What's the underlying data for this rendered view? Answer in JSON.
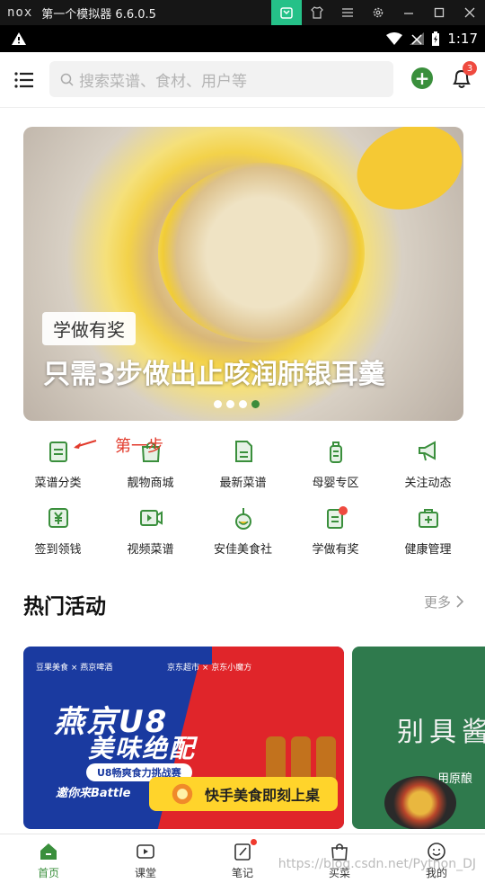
{
  "emulator": {
    "logo": "nox",
    "title": "第一个模拟器 6.6.0.5",
    "buttons": [
      "download-icon",
      "shirt-icon",
      "menu-icon",
      "gear-icon",
      "minimize-icon",
      "maximize-icon",
      "close-icon"
    ],
    "accent": "#25c188"
  },
  "status": {
    "time": "1:17"
  },
  "search": {
    "placeholder": "搜索菜谱、食材、用户等"
  },
  "notifications": {
    "badge": "3"
  },
  "banner": {
    "tag": "学做有奖",
    "title": "只需3步做出止咳润肺银耳羹",
    "dots": 4,
    "active_dot": 4
  },
  "categories": [
    {
      "label": "菜谱分类",
      "icon": "recipe-category-icon"
    },
    {
      "label": "靓物商城",
      "icon": "shopping-bag-icon"
    },
    {
      "label": "最新菜谱",
      "icon": "new-recipe-icon"
    },
    {
      "label": "母婴专区",
      "icon": "baby-bottle-icon"
    },
    {
      "label": "关注动态",
      "icon": "megaphone-icon"
    },
    {
      "label": "签到领钱",
      "icon": "yen-icon"
    },
    {
      "label": "视频菜谱",
      "icon": "video-icon"
    },
    {
      "label": "安佳美食社",
      "icon": "anchor-food-icon"
    },
    {
      "label": "学做有奖",
      "icon": "prize-recipe-icon"
    },
    {
      "label": "健康管理",
      "icon": "health-kit-icon"
    }
  ],
  "annotation": {
    "text": "第一步",
    "color": "#e23a2b"
  },
  "hot": {
    "title": "热门活动",
    "more": "更多"
  },
  "cards": {
    "card1": {
      "brand_left": "豆果美食 × 燕京啤酒",
      "brand_right": "京东超市 × 京东小魔方",
      "headline1": "燕京U8",
      "headline2": "美味绝配",
      "pill": "U8畅爽食力挑战赛",
      "invite": "邀你来Battle"
    },
    "cta": "快手美食即刻上桌",
    "card2": {
      "title": "别具酱",
      "sub": "用原酿"
    }
  },
  "tabs": [
    {
      "label": "首页",
      "icon": "home-icon"
    },
    {
      "label": "课堂",
      "icon": "play-icon"
    },
    {
      "label": "笔记",
      "icon": "note-edit-icon"
    },
    {
      "label": "买菜",
      "icon": "bag-icon"
    },
    {
      "label": "我的",
      "icon": "smile-icon"
    }
  ],
  "theme": {
    "green": "#3a8f3c",
    "badge_red": "#ef4a3f"
  },
  "watermark": "https://blog.csdn.net/Python_DJ"
}
